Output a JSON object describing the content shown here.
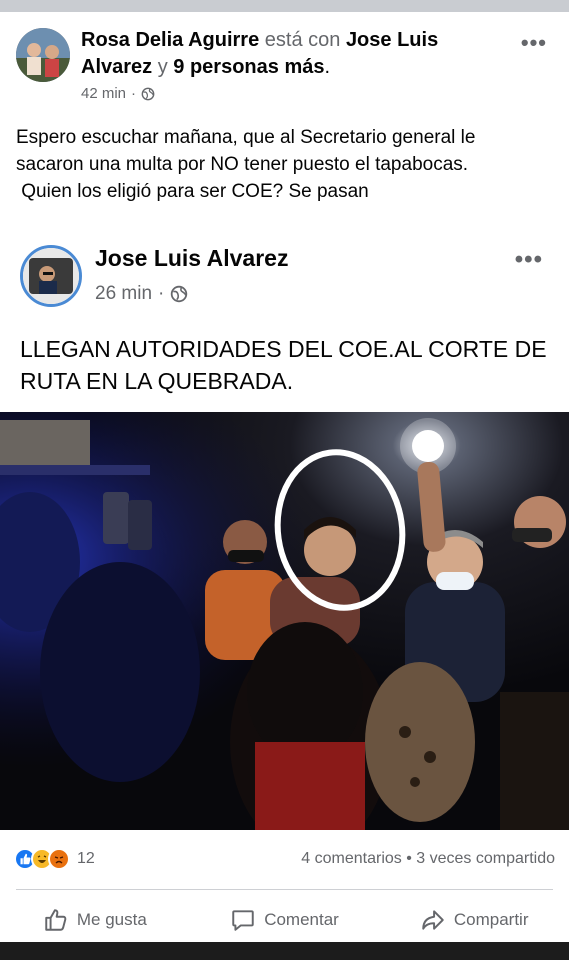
{
  "post": {
    "author": "Rosa Delia Aguirre",
    "with_text": "está con",
    "tagged": "Jose Luis Alvarez",
    "and_text": "y",
    "others": "9 personas más",
    "time": "42 min",
    "lines": [
      "Espero escuchar mañana, que al Secretario general le",
      "sacaron una multa por NO tener puesto el tapabocas.",
      " Quien los eligió para ser COE? Se pasan"
    ]
  },
  "shared": {
    "author": "Jose Luis Alvarez",
    "time": "26 min",
    "lines": [
      "LLEGAN AUTORIDADES DEL COE.AL CORTE DE",
      "RUTA EN LA QUEBRADA."
    ]
  },
  "stats": {
    "reaction_count": "12",
    "comments_shares": "4 comentarios • 3 veces compartido"
  },
  "actions": {
    "like": "Me gusta",
    "comment": "Comentar",
    "share": "Compartir"
  },
  "icons": {
    "more": "more-horizontal-icon",
    "audience": "globe-icon",
    "like": "thumbs-up-icon",
    "comment": "comment-bubble-icon",
    "share": "share-arrow-icon"
  },
  "colors": {
    "text": "#050505",
    "secondary": "#65676b",
    "like_blue": "#1877f2",
    "avatar_ring": "#4a8ad4"
  }
}
